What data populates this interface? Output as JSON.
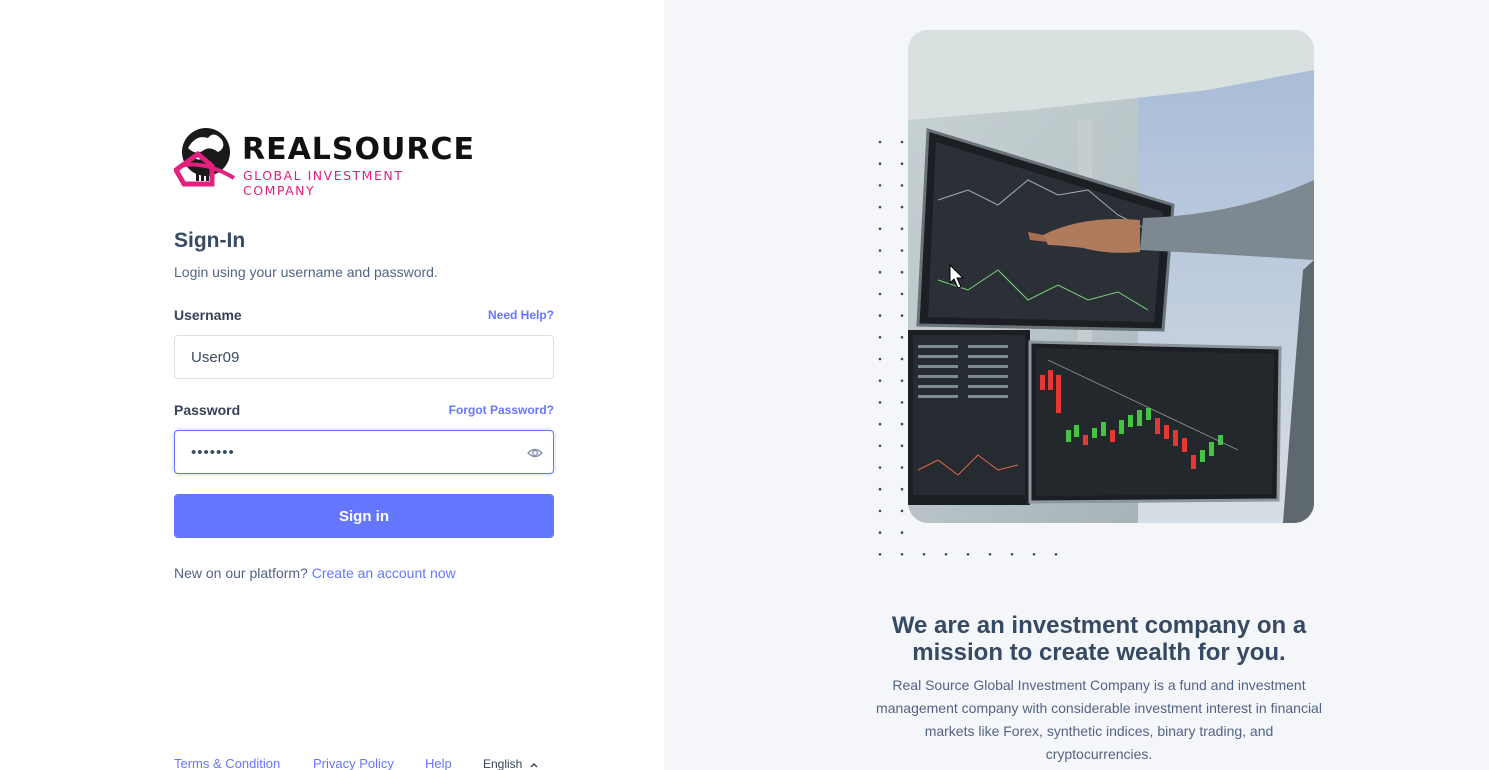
{
  "logo": {
    "name": "REALSOURCE",
    "tagline": "GLOBAL INVESTMENT COMPANY"
  },
  "signin": {
    "title": "Sign-In",
    "subtitle": "Login using your username and password.",
    "username_label": "Username",
    "username_help": "Need Help?",
    "username_value": "User09",
    "password_label": "Password",
    "password_help": "Forgot Password?",
    "password_value": "•••••••",
    "submit_label": "Sign in",
    "new_prompt": "New on our platform?",
    "create_link": "Create an account now"
  },
  "footer": {
    "terms": "Terms & Condition",
    "privacy": "Privacy Policy",
    "help": "Help",
    "language": "English"
  },
  "promo": {
    "headline": "We are an investment company on a mission to create wealth for you.",
    "description": "Real Source Global Investment Company is a fund and investment management company with considerable investment interest in financial markets like Forex, synthetic indices, binary trading, and cryptocurrencies."
  },
  "colors": {
    "accent": "#6576ff",
    "brand_pink": "#e3207c",
    "panel_bg": "#f5f6fa"
  },
  "icons": {
    "password_toggle": "eye-icon",
    "language_caret": "chevron-up-icon"
  }
}
